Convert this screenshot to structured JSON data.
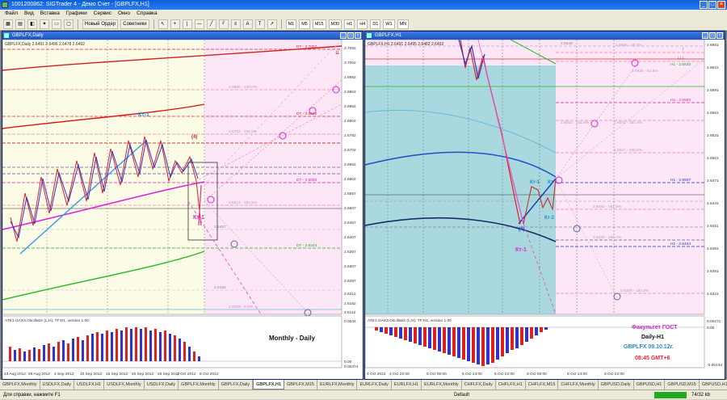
{
  "window": {
    "title": "1001200862: SIGTrader 4 - Демо Счет - [GBPLFX,H1]"
  },
  "menu": [
    "Файл",
    "Вид",
    "Вставка",
    "Графики",
    "Сервис",
    "Окно",
    "Справка"
  ],
  "toolbar": {
    "new_order": "Новый Ордер",
    "advisors": "Советники",
    "timeframes": [
      "M1",
      "M5",
      "M15",
      "M30",
      "H1",
      "H4",
      "D1",
      "W1",
      "MN"
    ]
  },
  "left_chart": {
    "window_title": "GBPLFX,Daily",
    "info": "GBPLFX,Daily  2.6491 2.6496 2.6478 2.6492",
    "prices": [
      "2.7052",
      "2.7002",
      "2.6952",
      "2.6902",
      "2.6852",
      "2.6802",
      "2.6752",
      "2.6702",
      "2.6652",
      "2.6602",
      "2.6557",
      "2.6507",
      "2.6457",
      "2.6407",
      "2.6357",
      "2.6307",
      "2.6257",
      "2.6212",
      "2.6162",
      "2.6112"
    ],
    "level_labels": [
      {
        "text": "DT - 2.7057",
        "color": "#d23"
      },
      {
        "text": "2.6955 - 100.0%",
        "color": "#b9b"
      },
      {
        "text": "DT - 2.6842",
        "color": "#d23"
      },
      {
        "text": "2.6783 - 161.8%",
        "color": "#b9b"
      },
      {
        "text": "DT - 2.6693",
        "color": "#d2a"
      },
      {
        "text": "2.6512 - 161.8%",
        "color": "#b9b"
      },
      {
        "text": "2.6467",
        "color": "#888"
      },
      {
        "text": "DT - 2.6344",
        "color": "#2a2"
      },
      {
        "text": "2.6192",
        "color": "#888"
      },
      {
        "text": "2.6083 - 0.0%",
        "color": "#b9b"
      }
    ],
    "wave_labels": {
      "kt1_top": "Кт-1",
      "kt1_bottom": "Кт-1",
      "point_4": "(4)"
    },
    "dates": [
      "23 Aug 2012",
      "29 Aug 2012",
      "4 Sep 2012",
      "10 Sep 2012",
      "16 Sep 2012",
      "20 Sep 2012",
      "26 Sep 2012",
      "2 Oct 2012",
      "8 Oct 2012"
    ],
    "oscillator_title": "ATE1.GAX3.Oscillator (L,H), TF:D1, version 1.00",
    "oscillator_label": "Monthly - Daily",
    "osc_levels": [
      "0.00",
      "0.0044",
      "0.00374"
    ]
  },
  "right_chart": {
    "window_title": "GBPLFX,H1",
    "info": "GBPLFX,H1  2.6491 2.6495 2.6482 2.6492",
    "prices": [
      "2.6651",
      "2.6621",
      "2.6591",
      "2.6561",
      "2.6531",
      "2.6501",
      "2.6471",
      "2.6441",
      "2.6411",
      "2.6381",
      "2.6351",
      "2.6321"
    ],
    "level_labels": [
      {
        "text": "2.6649",
        "color": "#888"
      },
      {
        "text": "2.6685 - 38.2%",
        "color": "#b9b"
      },
      {
        "text": "H1 - 2.6633",
        "color": "#2a2"
      },
      {
        "text": "2.6635 - 61.8%",
        "color": "#b9b"
      },
      {
        "text": "H1 - 2.6593",
        "color": "#d2a"
      },
      {
        "text": "2.6552 - 161.8%",
        "color": "#b9b"
      },
      {
        "text": "2.6572 - 161.8%",
        "color": "#b9b"
      },
      {
        "text": "2.6537 - 100.0%",
        "color": "#b9b"
      },
      {
        "text": "H1 - 2.6507",
        "color": "#23b"
      },
      {
        "text": "2.6483 - 161.8%",
        "color": "#b9b"
      },
      {
        "text": "2.6439 - 200.0%",
        "color": "#b9b"
      },
      {
        "text": "H1 - 2.6444",
        "color": "#23b"
      },
      {
        "text": "2.6380 - 161.8%",
        "color": "#b9b"
      }
    ],
    "wave_labels": {
      "kt1_a": "Кт-1",
      "kt1_b": "Кт",
      "kt2": "Кт-2",
      "kt1_bottom": "Кт-1",
      "point_4": "(4)"
    },
    "dates": [
      "4 Oct 2012",
      "4 Oct 22:00",
      "5 Oct 06:00",
      "5 Oct 14:00",
      "5 Oct 22:00",
      "8 Oct 06:00",
      "8 Oct 14:00",
      "8 Oct 22:00"
    ],
    "oscillator_title": "ATE1.GAX3.Oscillator (L,H), TF:H1, version 1.00",
    "oscillator_labels": {
      "line1": "Факультет ГОСТ",
      "line2": "Daily-H1",
      "line3": "GBPLFX 09.10.12г.",
      "line4": "08:45 GMT+6"
    },
    "osc_levels": [
      "0.00271",
      "0.00",
      "-0.00134"
    ]
  },
  "tabs": [
    "GBPLFX,Monthly",
    "USDLFX,Daily",
    "USDLFX,H1",
    "USDLFX,Monthly",
    "USDLFX,Daily",
    "GBPLFX,Monthly",
    "GBPLFX,Daily",
    "GBPLFX,H1",
    "GBPLFX,M15",
    "EURLFX,Monthly",
    "EURLFX,Daily",
    "EURLFX,H1",
    "EURLFX,Monthly",
    "CHFLFX,Daily",
    "CHFLFX,H1",
    "CHFLFX,M15",
    "CHFLFX,Monthly",
    "GBPUSD,Daily",
    "GBPUSD,H1",
    "GBPUSD,M15",
    "GBPUSD,H1"
  ],
  "active_tab": "GBPLFX,H1",
  "status": {
    "help": "Для справки, нажмите F1",
    "profile": "Default",
    "traffic": "74/32 kb"
  }
}
